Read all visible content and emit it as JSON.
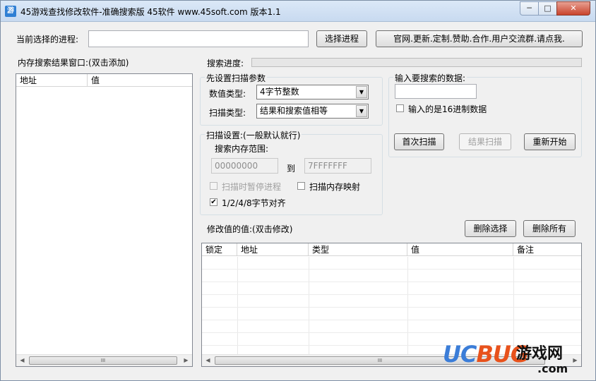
{
  "window": {
    "title": "45游戏查找修改软件-准确搜索版 45软件 www.45soft.com 版本1.1",
    "icon_text": "游",
    "min_glyph": "─",
    "max_glyph": "□",
    "close_glyph": "✕"
  },
  "process_row": {
    "label": "当前选择的进程:",
    "value": "",
    "select_button": "选择进程",
    "website_button": "官网.更新.定制.赞助.合作.用户交流群.请点我."
  },
  "results": {
    "label": "内存搜索结果窗口:(双击添加)",
    "columns": [
      "地址",
      "值"
    ]
  },
  "progress": {
    "label": "搜索进度:",
    "value": 0
  },
  "scan_params": {
    "group_title": "先设置扫描参数",
    "value_type_label": "数值类型:",
    "value_type": "4字节整数",
    "scan_type_label": "扫描类型:",
    "scan_type": "结果和搜索值相等"
  },
  "search_input": {
    "group_title": "输入要搜索的数据:",
    "value": "",
    "hex_checkbox_label": "输入的是16进制数据",
    "hex_checked": false,
    "first_scan_button": "首次扫描",
    "result_scan_button": "结果扫描",
    "restart_button": "重新开始"
  },
  "scan_settings": {
    "group_title": "扫描设置:(一般默认就行)",
    "range_label": "搜索内存范围:",
    "range_from": "00000000",
    "to_label": "到",
    "range_to": "7FFFFFFF",
    "pause_label": "扫描时暂停进程",
    "pause_checked": false,
    "mapped_label": "扫描内存映射",
    "mapped_checked": false,
    "align_label": "1/2/4/8字节对齐",
    "align_checked": true,
    "check_glyph": "✔"
  },
  "modify": {
    "label": "修改值的值:(双击修改)",
    "delete_selected_button": "删除选择",
    "delete_all_button": "删除所有",
    "columns": [
      "锁定",
      "地址",
      "类型",
      "值",
      "备注"
    ]
  },
  "scrollbar": {
    "left_glyph": "◀",
    "right_glyph": "▶",
    "thumb_glyph": "III"
  },
  "watermark": {
    "uc": "UC",
    "bug": "BUG",
    "cn": "游戏网",
    "com": ".com",
    "colors": {
      "uc": "#3b7dd8",
      "bug": "#e8521c"
    }
  }
}
